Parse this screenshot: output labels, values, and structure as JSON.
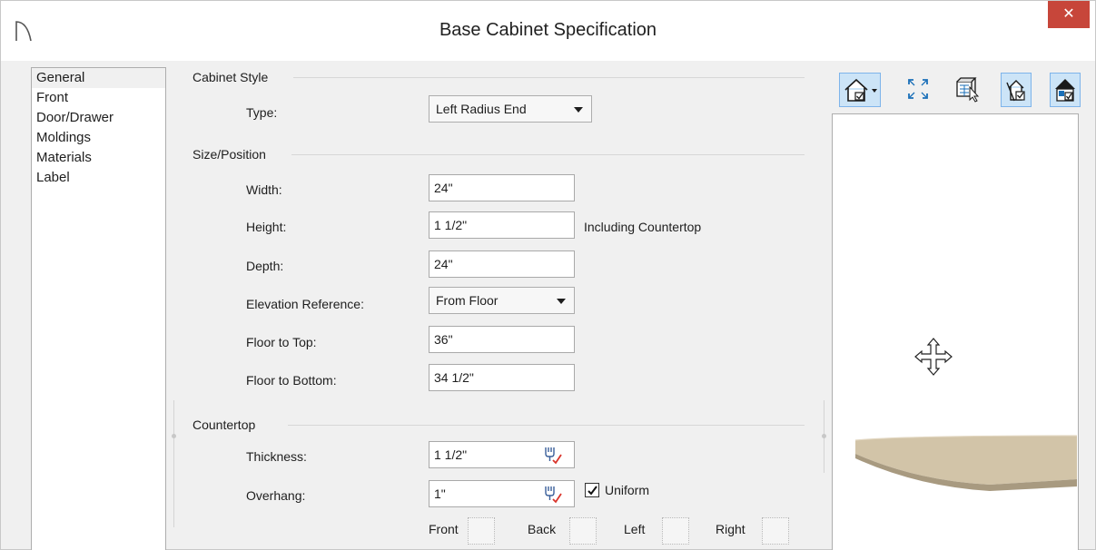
{
  "window": {
    "title": "Base Cabinet Specification",
    "close_glyph": "✕"
  },
  "nav": {
    "items": [
      {
        "label": "General",
        "selected": true
      },
      {
        "label": "Front"
      },
      {
        "label": "Door/Drawer"
      },
      {
        "label": "Moldings"
      },
      {
        "label": "Materials"
      },
      {
        "label": "Label"
      }
    ]
  },
  "cabinet_style": {
    "header": "Cabinet Style",
    "type_label": "Type:",
    "type_value": "Left Radius End"
  },
  "size_position": {
    "header": "Size/Position",
    "width_label": "Width:",
    "width_value": "24\"",
    "height_label": "Height:",
    "height_value": "1 1/2\"",
    "height_note": "Including Countertop",
    "depth_label": "Depth:",
    "depth_value": "24\"",
    "elevation_label": "Elevation Reference:",
    "elevation_value": "From Floor",
    "floor_top_label": "Floor to Top:",
    "floor_top_value": "36\"",
    "floor_bottom_label": "Floor to Bottom:",
    "floor_bottom_value": "34 1/2\""
  },
  "countertop": {
    "header": "Countertop",
    "thickness_label": "Thickness:",
    "thickness_value": "1 1/2\"",
    "overhang_label": "Overhang:",
    "overhang_value": "1\"",
    "uniform_label": "Uniform",
    "uniform_checked": true,
    "front_label": "Front",
    "back_label": "Back",
    "left_label": "Left",
    "right_label": "Right"
  },
  "preview": {
    "toolbar_icons": [
      "camera-view-dropdown-icon",
      "fill-window-icon",
      "select-objects-icon",
      "show-dimensions-icon",
      "show-materials-icon"
    ]
  },
  "colors": {
    "close": "#c7463a",
    "countertop": "#cdbfa3",
    "pressed": "#cce4f7"
  }
}
